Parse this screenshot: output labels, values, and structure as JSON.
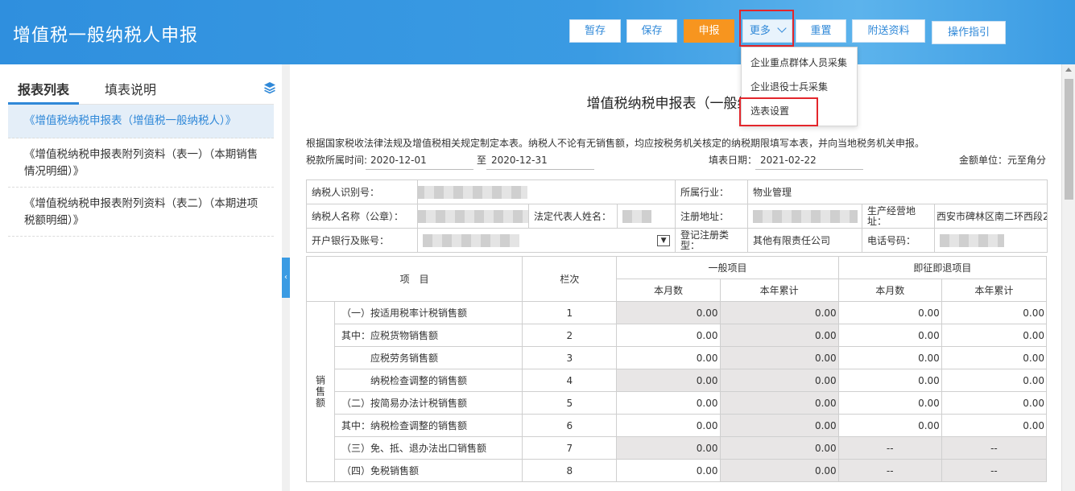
{
  "header": {
    "title": "增值税一般纳税人申报",
    "buttons": {
      "temp_save": "暂存",
      "save": "保存",
      "declare": "申报",
      "more": "更多",
      "reset": "重置",
      "attach": "附送资料",
      "guide": "操作指引"
    }
  },
  "more_menu": {
    "items": [
      "企业重点群体人员采集",
      "企业退役士兵采集",
      "选表设置"
    ]
  },
  "sidebar": {
    "tabs": [
      "报表列表",
      "填表说明"
    ],
    "items": [
      "《增值税纳税申报表（增值税一般纳税人）》",
      "《增值税纳税申报表附列资料（表一）（本期销售情况明细）》",
      "《增值税纳税申报表附列资料（表二）（本期进项税额明细）》"
    ]
  },
  "form": {
    "title": "增值税纳税申报表（一般纳税",
    "notice": "根据国家税收法律法规及增值税相关规定制定本表。纳税人不论有无销售额，均应按税务机关核定的纳税期限填写本表，并向当地税务机关申报。",
    "period_label": "税款所属时间:",
    "period_from": "2020-12-01",
    "period_to_label": "至",
    "period_to": "2020-12-31",
    "fill_date_label": "填表日期：",
    "fill_date": "2021-02-22",
    "unit": "金额单位：元至角分"
  },
  "info": {
    "taxpayer_id_label": "纳税人识别号：",
    "industry_label": "所属行业：",
    "industry": "物业管理",
    "taxpayer_name_label": "纳税人名称（公章）：",
    "legal_rep_label": "法定代表人姓名：",
    "reg_address_label": "注册地址：",
    "biz_address_label": "生产经营地址：",
    "biz_address": "西安市碑林区南二环西段2",
    "bank_label": "开户银行及账号：",
    "reg_type_label": "登记注册类型：",
    "reg_type": "其他有限责任公司",
    "phone_label": "电话号码："
  },
  "table": {
    "headers": {
      "item": "项　目",
      "line": "栏次",
      "general": "一般项目",
      "immediate": "即征即退项目",
      "month": "本月数",
      "year": "本年累计"
    },
    "section_label": "销售额",
    "rows": [
      {
        "label": "（一）按适用税率计税销售额",
        "line": "1",
        "v": [
          "0.00",
          "0.00",
          "0.00",
          "0.00"
        ]
      },
      {
        "label": "其中：应税货物销售额",
        "line": "2",
        "v": [
          "0.00",
          "0.00",
          "0.00",
          "0.00"
        ]
      },
      {
        "label": "应税劳务销售额",
        "line": "3",
        "v": [
          "0.00",
          "0.00",
          "0.00",
          "0.00"
        ]
      },
      {
        "label": "纳税检查调整的销售额",
        "line": "4",
        "v": [
          "0.00",
          "0.00",
          "0.00",
          "0.00"
        ]
      },
      {
        "label": "（二）按简易办法计税销售额",
        "line": "5",
        "v": [
          "0.00",
          "0.00",
          "0.00",
          "0.00"
        ]
      },
      {
        "label": "其中：纳税检查调整的销售额",
        "line": "6",
        "v": [
          "0.00",
          "0.00",
          "0.00",
          "0.00"
        ]
      },
      {
        "label": "（三）免、抵、退办法出口销售额",
        "line": "7",
        "v": [
          "0.00",
          "0.00",
          "--",
          "--"
        ]
      },
      {
        "label": "（四）免税销售额",
        "line": "8",
        "v": [
          "0.00",
          "0.00",
          "--",
          "--"
        ]
      }
    ]
  }
}
